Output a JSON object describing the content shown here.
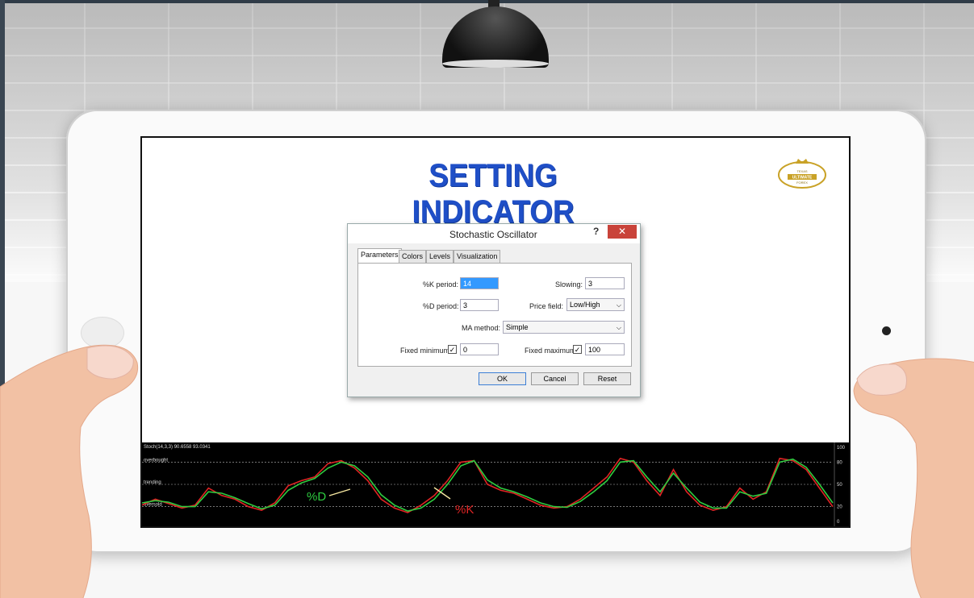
{
  "title": "SETTING INDICATOR",
  "logo": {
    "top": "TEXAS",
    "middle": "ULTIMATE",
    "bottom": "FOREX",
    "colors": {
      "gold": "#c9a227"
    }
  },
  "dialog": {
    "title": "Stochastic Oscillator",
    "help_label": "?",
    "close_label": "✕",
    "tabs": [
      "Parameters",
      "Colors",
      "Levels",
      "Visualization"
    ],
    "k_period_label": "%K period:",
    "k_period_value": "14",
    "d_period_label": "%D period:",
    "d_period_value": "3",
    "slowing_label": "Slowing:",
    "slowing_value": "3",
    "price_field_label": "Price field:",
    "price_field_value": "Low/High",
    "ma_method_label": "MA method:",
    "ma_method_value": "Simple",
    "fixed_min_label": "Fixed minimum",
    "fixed_min_checked": true,
    "fixed_min_value": "0",
    "fixed_max_label": "Fixed maximum",
    "fixed_max_checked": true,
    "fixed_max_value": "100",
    "ok_label": "OK",
    "cancel_label": "Cancel",
    "reset_label": "Reset",
    "check_mark": "✓"
  },
  "chart_data": {
    "type": "line",
    "header": "Stoch(14,3,3) 90.6558 93.0341",
    "level_labels": [
      "overbought",
      "trending",
      "oversold"
    ],
    "levels": [
      80,
      50,
      20
    ],
    "ylim": [
      0,
      100
    ],
    "axis_ticks": [
      "100",
      "80",
      "50",
      "20",
      "0"
    ],
    "annotations": [
      "%D",
      "%K"
    ],
    "colors": {
      "k": "#e02424",
      "d": "#2ecc40",
      "grid": "#bbbbbb"
    },
    "series": [
      {
        "name": "%K",
        "values": [
          22,
          30,
          24,
          18,
          22,
          45,
          35,
          30,
          20,
          15,
          25,
          48,
          55,
          60,
          78,
          82,
          72,
          55,
          30,
          18,
          12,
          22,
          35,
          55,
          80,
          82,
          50,
          42,
          38,
          30,
          22,
          18,
          20,
          30,
          45,
          60,
          85,
          80,
          55,
          35,
          70,
          40,
          22,
          15,
          20,
          45,
          30,
          40,
          85,
          82,
          70,
          45,
          20
        ]
      },
      {
        "name": "%D",
        "values": [
          25,
          28,
          26,
          20,
          20,
          40,
          38,
          32,
          24,
          17,
          22,
          42,
          52,
          58,
          72,
          80,
          75,
          60,
          36,
          22,
          14,
          18,
          30,
          50,
          75,
          82,
          56,
          45,
          40,
          33,
          25,
          20,
          19,
          27,
          40,
          55,
          80,
          82,
          60,
          40,
          65,
          45,
          26,
          18,
          18,
          40,
          34,
          38,
          80,
          84,
          73,
          50,
          25
        ]
      }
    ]
  }
}
